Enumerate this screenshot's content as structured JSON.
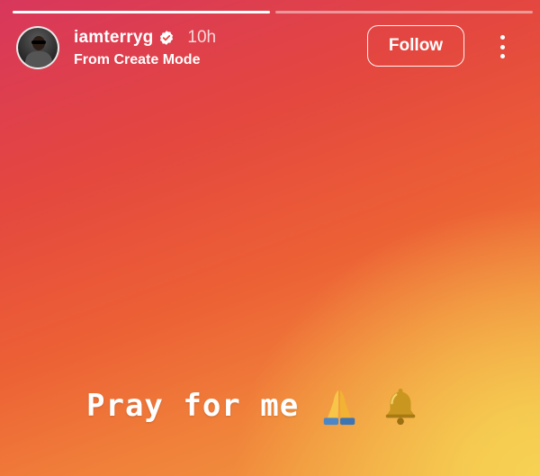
{
  "story": {
    "progress": [
      1.0,
      0.0
    ],
    "username": "iamterryg",
    "verified": true,
    "time": "10h",
    "subtitle": "From Create Mode",
    "follow_label": "Follow",
    "caption": "Pray for me",
    "emojis": [
      "praying-hands-icon",
      "bell-icon"
    ]
  },
  "colors": {
    "gradient_top": "#d8375c",
    "gradient_mid": "#ec6035",
    "gradient_corner": "#f6d253"
  }
}
